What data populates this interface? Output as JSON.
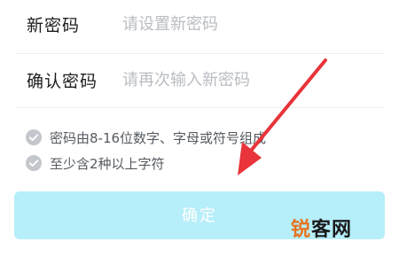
{
  "form": {
    "new_password": {
      "label": "新密码",
      "placeholder": "请设置新密码",
      "value": ""
    },
    "confirm_password": {
      "label": "确认密码",
      "placeholder": "请再次输入新密码",
      "value": ""
    }
  },
  "rules": [
    {
      "text": "密码由8-16位数字、字母或符号组成",
      "icon": "check-circle-icon",
      "satisfied": false
    },
    {
      "text": "至少含2种以上字符",
      "icon": "check-circle-icon",
      "satisfied": false
    }
  ],
  "confirm_button": {
    "label": "确定",
    "enabled": false
  },
  "watermark": {
    "accent_char": "锐",
    "rest": "客网"
  },
  "colors": {
    "button_disabled_bg": "#b6eef9",
    "check_icon_gray": "#c3c6cb",
    "annotation_arrow": "#e8343a",
    "placeholder": "#b9bcc2"
  }
}
